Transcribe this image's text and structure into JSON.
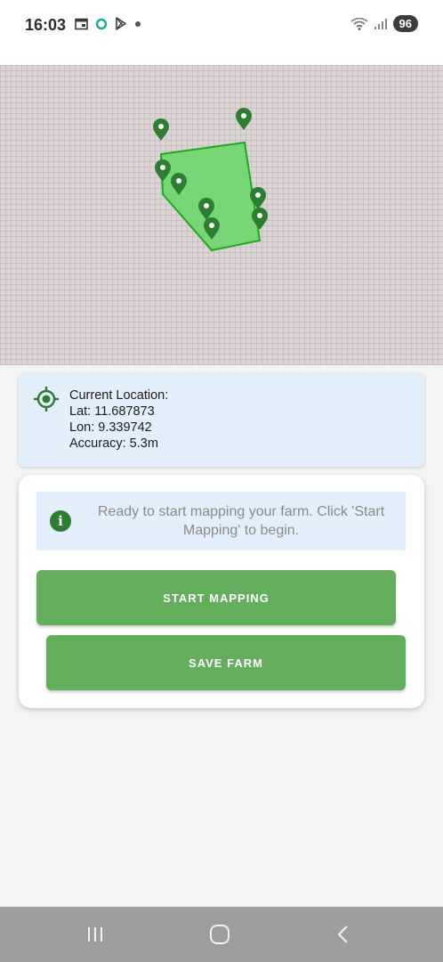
{
  "status_bar": {
    "time": "16:03",
    "battery": "96",
    "icons": [
      "calendar-icon",
      "ring-icon",
      "play-store-icon",
      "dot-icon",
      "wifi-icon",
      "signal-icon"
    ]
  },
  "map": {
    "marker_color": "#2e7d32",
    "polygon_fill": "#66d866",
    "polygon_stroke": "#1fa71f",
    "markers": 8
  },
  "location": {
    "title": "Current Location:",
    "lat": "Lat: 11.687873",
    "lon": "Lon: 9.339742",
    "accuracy": "Accuracy: 5.3m"
  },
  "info": {
    "message": "Ready to start mapping your farm. Click 'Start Mapping' to begin."
  },
  "actions": {
    "start_label": "START MAPPING",
    "save_label": "SAVE FARM"
  },
  "colors": {
    "accent": "#63ad5c",
    "card_bg": "#e3f0fb"
  },
  "nav": {
    "icons": [
      "recent-apps-icon",
      "home-icon",
      "back-icon"
    ]
  }
}
